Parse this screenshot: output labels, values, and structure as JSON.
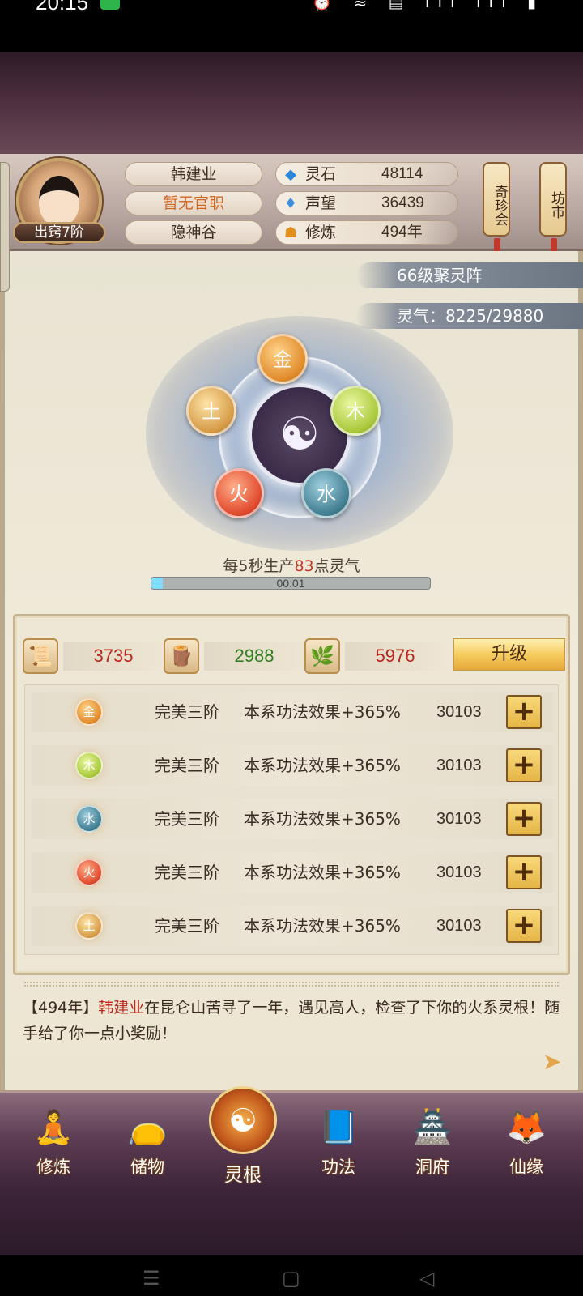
{
  "status": {
    "time": "20:15",
    "icons": "⏰ ≋ ▤ ıll ıll ▮"
  },
  "header": {
    "avatar_rank": "出窍7阶",
    "name": "韩建业",
    "title": "暂无官职",
    "sect": "隐神谷",
    "resources": [
      {
        "icon": "spirit-stone-icon",
        "glyph": "◆",
        "label": "灵石",
        "value": "48114"
      },
      {
        "icon": "reputation-icon",
        "glyph": "♦",
        "label": "声望",
        "value": "36439"
      },
      {
        "icon": "meditation-icon",
        "glyph": "☗",
        "label": "修炼",
        "value": "494年"
      }
    ],
    "treasure_button": "奇珍会",
    "market_button": "坊市"
  },
  "formation": {
    "level_label": "66级聚灵阵",
    "qi_label": "灵气：8225/29880",
    "elements": [
      {
        "char": "金",
        "key": "gold"
      },
      {
        "char": "木",
        "key": "wood"
      },
      {
        "char": "水",
        "key": "water"
      },
      {
        "char": "火",
        "key": "fire"
      },
      {
        "char": "土",
        "key": "earth"
      }
    ],
    "taiji": "☯",
    "produce_prefix": "每5秒生产",
    "produce_amount": "83",
    "produce_suffix": "点灵气",
    "timer": "00:01",
    "progress": 0.04
  },
  "materials": [
    {
      "icon": "scroll-icon",
      "glyph": "📜",
      "value": "3735",
      "color": "#b8261c"
    },
    {
      "icon": "wood-log-icon",
      "glyph": "🪵",
      "value": "2988",
      "color": "#2e7d1e"
    },
    {
      "icon": "herb-icon",
      "glyph": "🌿",
      "value": "5976",
      "color": "#b8261c"
    }
  ],
  "upgrade_label": "升级",
  "roots": [
    {
      "element": "金",
      "key": "gold",
      "level": "完美三阶",
      "effect": "本系功法效果+365%",
      "cost": "30103"
    },
    {
      "element": "木",
      "key": "wood",
      "level": "完美三阶",
      "effect": "本系功法效果+365%",
      "cost": "30103"
    },
    {
      "element": "水",
      "key": "water",
      "level": "完美三阶",
      "effect": "本系功法效果+365%",
      "cost": "30103"
    },
    {
      "element": "火",
      "key": "fire",
      "level": "完美三阶",
      "effect": "本系功法效果+365%",
      "cost": "30103"
    },
    {
      "element": "土",
      "key": "earth",
      "level": "完美三阶",
      "effect": "本系功法效果+365%",
      "cost": "30103"
    }
  ],
  "log": {
    "prefix": "【494年】",
    "name": "韩建业",
    "text": "在昆仑山苦寻了一年，遇见高人，检查了下你的火系灵根！随手给了你一点小奖励！"
  },
  "nav": [
    {
      "label": "修炼",
      "icon": "cultivation-icon",
      "glyph": "🧘"
    },
    {
      "label": "储物",
      "icon": "storage-bag-icon",
      "glyph": "👝"
    },
    {
      "label": "灵根",
      "icon": "spirit-root-icon",
      "glyph": "☯",
      "active": true
    },
    {
      "label": "功法",
      "icon": "manual-book-icon",
      "glyph": "📘"
    },
    {
      "label": "洞府",
      "icon": "cave-dwelling-icon",
      "glyph": "🏯"
    },
    {
      "label": "仙缘",
      "icon": "fortune-icon",
      "glyph": "🦊"
    }
  ],
  "system_nav": {
    "menu": "☰",
    "home": "▢",
    "back": "◁"
  },
  "colors": {
    "accent_red": "#b8261c",
    "accent_orange": "#d3641c",
    "gold": "#f5c95a"
  }
}
